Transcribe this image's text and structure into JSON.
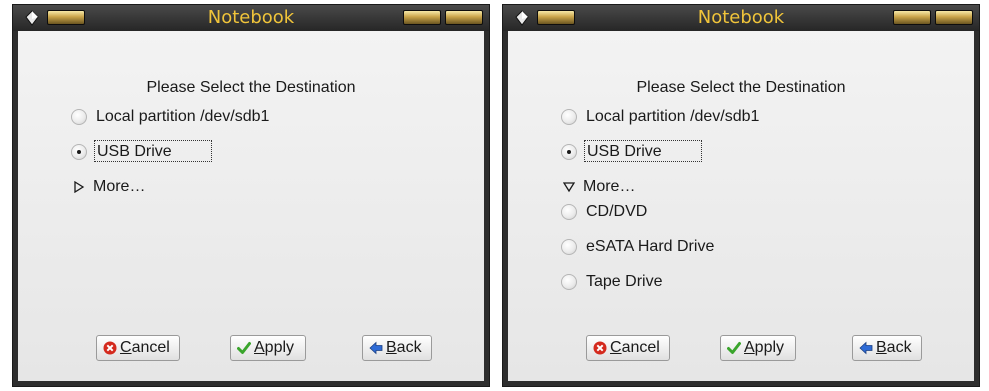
{
  "left": {
    "title": "Notebook",
    "heading": "Please Select the Destination",
    "options": [
      {
        "label": "Local partition /dev/sdb1",
        "selected": false
      },
      {
        "label": "USB Drive",
        "selected": true
      }
    ],
    "more_label": "More…",
    "more_expanded": false,
    "buttons": {
      "cancel_mnemonic": "C",
      "cancel_rest": "ancel",
      "apply_mnemonic": "A",
      "apply_rest": "pply",
      "back_mnemonic": "B",
      "back_rest": "ack"
    }
  },
  "right": {
    "title": "Notebook",
    "heading": "Please Select the Destination",
    "options": [
      {
        "label": "Local partition /dev/sdb1",
        "selected": false
      },
      {
        "label": "USB Drive",
        "selected": true
      }
    ],
    "more_label": "More…",
    "more_expanded": true,
    "extra_options": [
      {
        "label": "CD/DVD",
        "selected": false
      },
      {
        "label": "eSATA Hard Drive",
        "selected": false
      },
      {
        "label": "Tape Drive",
        "selected": false
      }
    ],
    "buttons": {
      "cancel_mnemonic": "C",
      "cancel_rest": "ancel",
      "apply_mnemonic": "A",
      "apply_rest": "pply",
      "back_mnemonic": "B",
      "back_rest": "ack"
    }
  },
  "icons": {
    "window_menu": "window-menu-icon",
    "collapsed": "triangle-right-icon",
    "expanded": "triangle-down-icon",
    "cancel": "cancel-icon",
    "apply": "checkmark-icon",
    "back": "back-arrow-icon"
  },
  "colors": {
    "title_text": "#f0c43a",
    "frame": "#2e2e2e",
    "client_bg": "#ececec",
    "cancel_icon": "#d42a1e",
    "apply_icon": "#3aa52c",
    "back_icon": "#2e6bd6"
  }
}
